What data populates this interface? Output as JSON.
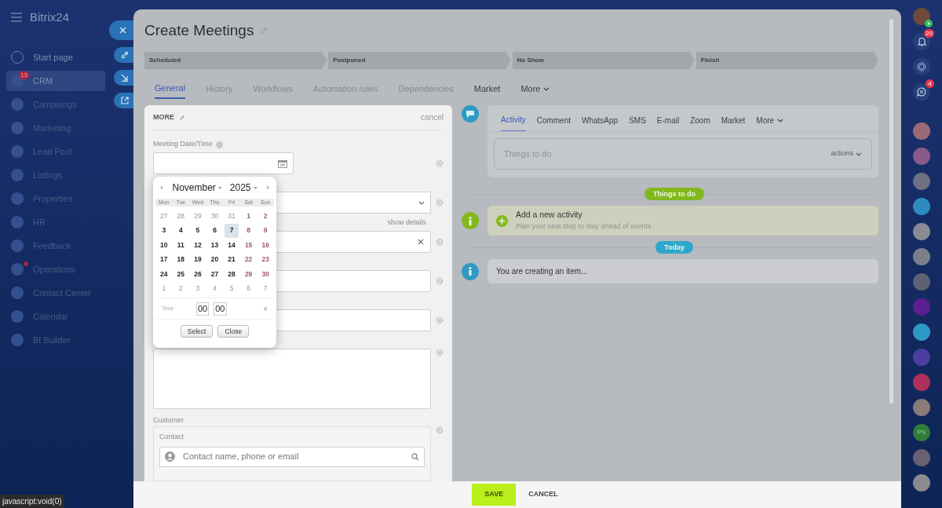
{
  "sidebar": {
    "logo": "Bitrix24",
    "items": [
      {
        "label": "Start page",
        "selected": false,
        "alert": false
      },
      {
        "label": "CRM",
        "selected": true,
        "badge": "13",
        "alert": false
      },
      {
        "label": "Campaings",
        "selected": false,
        "alert": false
      },
      {
        "label": "Marketing",
        "selected": false,
        "alert": false
      },
      {
        "label": "Lead Pool",
        "selected": false,
        "alert": false
      },
      {
        "label": "Listings",
        "selected": false,
        "alert": false
      },
      {
        "label": "Properties",
        "selected": false,
        "alert": false
      },
      {
        "label": "HR",
        "selected": false,
        "alert": false
      },
      {
        "label": "Feedback",
        "selected": false,
        "alert": false
      },
      {
        "label": "Operations",
        "selected": false,
        "alert": true
      },
      {
        "label": "Contact Center",
        "selected": false,
        "alert": false
      },
      {
        "label": "Calendar",
        "selected": false,
        "alert": false
      },
      {
        "label": "BI Builder",
        "selected": false,
        "alert": false
      }
    ]
  },
  "status_bar": "javascript:void(0)",
  "window": {
    "title": "Create Meetings"
  },
  "stages": [
    "Scheduled",
    "Postponed",
    "No Show",
    "Finish"
  ],
  "tabs": [
    {
      "label": "General",
      "selected": true,
      "disabled": false,
      "has_menu": false
    },
    {
      "label": "History",
      "selected": false,
      "disabled": true,
      "has_menu": false
    },
    {
      "label": "Workflows",
      "selected": false,
      "disabled": true,
      "has_menu": false
    },
    {
      "label": "Automation rules",
      "selected": false,
      "disabled": true,
      "has_menu": false
    },
    {
      "label": "Dependencies",
      "selected": false,
      "disabled": true,
      "has_menu": false
    },
    {
      "label": "Market",
      "selected": false,
      "disabled": false,
      "has_menu": false
    },
    {
      "label": "More",
      "selected": false,
      "disabled": false,
      "has_menu": true
    }
  ],
  "form": {
    "title": "MORE",
    "cancel": "cancel",
    "fields": [
      {
        "kind": "date",
        "label": "Meeting Date/Time"
      },
      {
        "kind": "select"
      },
      {
        "kind": "clearable",
        "link": "show details"
      },
      {
        "kind": "text"
      },
      {
        "kind": "text"
      },
      {
        "kind": "textarea"
      }
    ],
    "customer": {
      "label": "Customer",
      "contact_label": "Contact",
      "placeholder": "Contact name, phone or email"
    }
  },
  "calendar": {
    "month": "November",
    "year": "2025",
    "weekdays": [
      "Mon",
      "Tue",
      "Wed",
      "Thu",
      "Fri",
      "Sat",
      "Sun"
    ],
    "weeks": [
      [
        {
          "day": "27",
          "kind": "other",
          "selected": false
        },
        {
          "day": "28",
          "kind": "other",
          "selected": false
        },
        {
          "day": "29",
          "kind": "other",
          "selected": false
        },
        {
          "day": "30",
          "kind": "other",
          "selected": false
        },
        {
          "day": "31",
          "kind": "other",
          "selected": false
        },
        {
          "day": "1",
          "kind": "weekend",
          "selected": false
        },
        {
          "day": "2",
          "kind": "weekend",
          "selected": false
        }
      ],
      [
        {
          "day": "3",
          "kind": "weekday",
          "selected": false
        },
        {
          "day": "4",
          "kind": "weekday",
          "selected": false
        },
        {
          "day": "5",
          "kind": "weekday",
          "selected": false
        },
        {
          "day": "6",
          "kind": "weekday",
          "selected": false
        },
        {
          "day": "7",
          "kind": "weekday",
          "selected": true
        },
        {
          "day": "8",
          "kind": "weekend",
          "selected": false
        },
        {
          "day": "9",
          "kind": "weekend",
          "selected": false
        }
      ],
      [
        {
          "day": "10",
          "kind": "weekday",
          "selected": false
        },
        {
          "day": "11",
          "kind": "weekday",
          "selected": false
        },
        {
          "day": "12",
          "kind": "weekday",
          "selected": false
        },
        {
          "day": "13",
          "kind": "weekday",
          "selected": false
        },
        {
          "day": "14",
          "kind": "weekday",
          "selected": false
        },
        {
          "day": "15",
          "kind": "weekend",
          "selected": false
        },
        {
          "day": "16",
          "kind": "weekend",
          "selected": false
        }
      ],
      [
        {
          "day": "17",
          "kind": "weekday",
          "selected": false
        },
        {
          "day": "18",
          "kind": "weekday",
          "selected": false
        },
        {
          "day": "19",
          "kind": "weekday",
          "selected": false
        },
        {
          "day": "20",
          "kind": "weekday",
          "selected": false
        },
        {
          "day": "21",
          "kind": "weekday",
          "selected": false
        },
        {
          "day": "22",
          "kind": "weekend",
          "selected": false
        },
        {
          "day": "23",
          "kind": "weekend",
          "selected": false
        }
      ],
      [
        {
          "day": "24",
          "kind": "weekday",
          "selected": false
        },
        {
          "day": "25",
          "kind": "weekday",
          "selected": false
        },
        {
          "day": "26",
          "kind": "weekday",
          "selected": false
        },
        {
          "day": "27",
          "kind": "weekday",
          "selected": false
        },
        {
          "day": "28",
          "kind": "weekday",
          "selected": false
        },
        {
          "day": "29",
          "kind": "weekend",
          "selected": false
        },
        {
          "day": "30",
          "kind": "weekend",
          "selected": false
        }
      ],
      [
        {
          "day": "1",
          "kind": "other",
          "selected": false
        },
        {
          "day": "2",
          "kind": "other",
          "selected": false
        },
        {
          "day": "3",
          "kind": "other",
          "selected": false
        },
        {
          "day": "4",
          "kind": "other",
          "selected": false
        },
        {
          "day": "5",
          "kind": "other",
          "selected": false
        },
        {
          "day": "6",
          "kind": "other",
          "selected": false
        },
        {
          "day": "7",
          "kind": "other",
          "selected": false
        }
      ]
    ],
    "time_label": "Time",
    "hours": "00",
    "minutes": "00",
    "clear": "×",
    "select": "Select",
    "close": "Close"
  },
  "activity": {
    "tabs": [
      {
        "label": "Activity",
        "selected": true,
        "has_menu": false
      },
      {
        "label": "Comment",
        "selected": false,
        "has_menu": false
      },
      {
        "label": "WhatsApp",
        "selected": false,
        "has_menu": false
      },
      {
        "label": "SMS",
        "selected": false,
        "has_menu": false
      },
      {
        "label": "E-mail",
        "selected": false,
        "has_menu": false
      },
      {
        "label": "Zoom",
        "selected": false,
        "has_menu": false
      },
      {
        "label": "Market",
        "selected": false,
        "has_menu": false
      },
      {
        "label": "More",
        "selected": false,
        "has_menu": true
      }
    ],
    "placeholder": "Things to do",
    "actions": "actions"
  },
  "timeline": [
    {
      "kind": "badge",
      "label": "Things to do",
      "color": "#82b81e"
    },
    {
      "kind": "add",
      "title": "Add a new activity",
      "subtitle": "Plan your next step to stay ahead of events"
    },
    {
      "kind": "badge",
      "label": "Today",
      "color": "#2fa7cd"
    },
    {
      "kind": "info",
      "text": "You are creating an item..."
    }
  ],
  "footer": {
    "save": "SAVE",
    "cancel": "CANCEL"
  },
  "right_bar": [
    {
      "kind": "user",
      "color": "#6b4a3a"
    },
    {
      "kind": "bell",
      "badge": "20"
    },
    {
      "kind": "copilot"
    },
    {
      "kind": "chat",
      "badge": "4"
    },
    {
      "kind": "avatar",
      "color": "#9a6a78"
    },
    {
      "kind": "avatar",
      "color": "#8a5a8a"
    },
    {
      "kind": "avatar",
      "color": "#6d7080"
    },
    {
      "kind": "avatar",
      "color": "#2e8bc0"
    },
    {
      "kind": "avatar",
      "color": "#8a8a95"
    },
    {
      "kind": "avatar",
      "color": "#7a7f8a"
    },
    {
      "kind": "avatar",
      "color": "#5d6272"
    },
    {
      "kind": "avatar",
      "color": "#5b1f8f"
    },
    {
      "kind": "avatar",
      "color": "#2b9ac8"
    },
    {
      "kind": "avatar",
      "color": "#4a3fa0"
    },
    {
      "kind": "avatar",
      "color": "#b0305c"
    },
    {
      "kind": "avatar",
      "color": "#8a7a78"
    },
    {
      "kind": "initials",
      "text": "PS",
      "color": "#2f7d3a"
    },
    {
      "kind": "avatar",
      "color": "#6a6070"
    },
    {
      "kind": "avatar",
      "color": "#8a8a8f"
    }
  ]
}
